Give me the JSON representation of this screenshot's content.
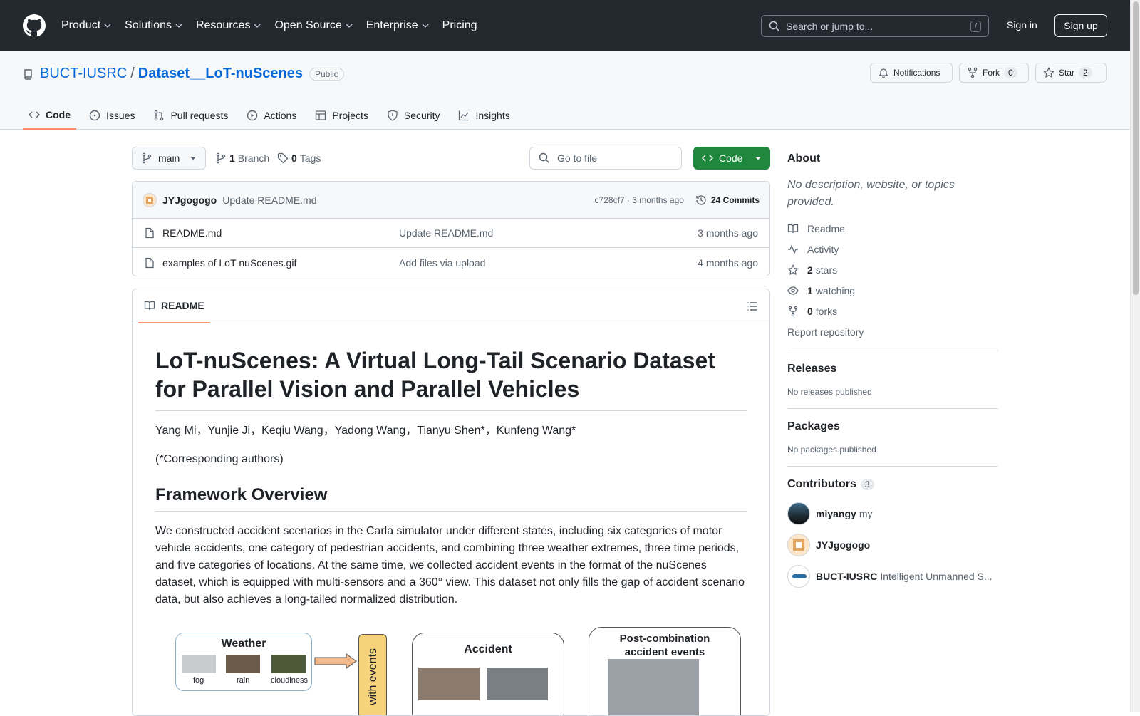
{
  "header": {
    "nav": [
      "Product",
      "Solutions",
      "Resources",
      "Open Source",
      "Enterprise",
      "Pricing"
    ],
    "search_placeholder": "Search or jump to...",
    "search_shortcut": "/",
    "signin": "Sign in",
    "signup": "Sign up"
  },
  "repo": {
    "owner": "BUCT-IUSRC",
    "separator": "/",
    "name": "Dataset__LoT-nuScenes",
    "visibility": "Public",
    "notifications": "Notifications",
    "fork_label": "Fork",
    "fork_count": "0",
    "star_label": "Star",
    "star_count": "2",
    "tabs": [
      "Code",
      "Issues",
      "Pull requests",
      "Actions",
      "Projects",
      "Security",
      "Insights"
    ]
  },
  "toolbar": {
    "branch": "main",
    "branch_count": "1",
    "branch_label": "Branch",
    "tag_count": "0",
    "tag_label": "Tags",
    "goto_placeholder": "Go to file",
    "code_button": "Code"
  },
  "commit": {
    "author": "JYJgogogo",
    "message": "Update README.md",
    "hash_time": "c728cf7 · 3 months ago",
    "count": "24 Commits"
  },
  "files": [
    {
      "name": "README.md",
      "message": "Update README.md",
      "time": "3 months ago"
    },
    {
      "name": "examples of LoT-nuScenes.gif",
      "message": "Add files via upload",
      "time": "4 months ago"
    }
  ],
  "readme": {
    "tab": "README",
    "title": "LoT-nuScenes: A Virtual Long-Tail Scenario Dataset for Parallel Vision and Parallel Vehicles",
    "authors": "Yang Mi，Yunjie Ji，Keqiu Wang，Yadong Wang，Tianyu Shen*，Kunfeng Wang*",
    "note": "(*Corresponding authors)",
    "section": "Framework Overview",
    "body": "We constructed accident scenarios in the Carla simulator under different states, including six categories of motor vehicle accidents, one category of pedestrian accidents, and combining three weather extremes, three time periods, and five categories of locations. At the same time, we collected accident events in the format of the nuScenes dataset, which is equipped with multi-sensors and a 360° view. This dataset not only fills the gap of accident scenario data, but also achieves a long-tailed normalized distribution.",
    "diagram": {
      "weather": "Weather",
      "fog": "fog",
      "rain": "rain",
      "cloudiness": "cloudiness",
      "with_events": "with events",
      "accident": "Accident",
      "post": "Post-combination accident events"
    }
  },
  "about": {
    "heading": "About",
    "description": "No description, website, or topics provided.",
    "readme": "Readme",
    "activity": "Activity",
    "stars_n": "2",
    "stars": "stars",
    "watching_n": "1",
    "watching": "watching",
    "forks_n": "0",
    "forks": "forks",
    "report": "Report repository"
  },
  "releases": {
    "heading": "Releases",
    "empty": "No releases published"
  },
  "packages": {
    "heading": "Packages",
    "empty": "No packages published"
  },
  "contributors": {
    "heading": "Contributors",
    "count": "3",
    "list": [
      {
        "login": "miyangy",
        "name": "my"
      },
      {
        "login": "JYJgogogo",
        "name": ""
      },
      {
        "login": "BUCT-IUSRC",
        "name": "Intelligent Unmanned S..."
      }
    ]
  },
  "colors": {
    "header_bg": "#24292f",
    "link": "#0969da",
    "primary_btn": "#1f883d",
    "tab_underline": "#fd8c73"
  }
}
